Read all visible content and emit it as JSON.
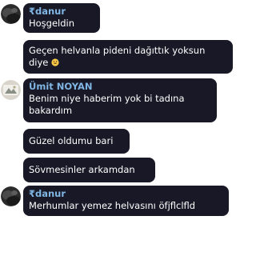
{
  "messages": [
    {
      "sender": "₹danur",
      "lines": [
        "Hoşgeldin"
      ]
    },
    {
      "sender": "",
      "lines": [
        "Geçen helvanla pideni dağıttık yoksun",
        "diye"
      ],
      "emoji": "grinning-sweat-emoji"
    },
    {
      "sender": "Ümit NOYAN",
      "lines": [
        "Benim niye haberim yok bi tadına",
        "bakardım"
      ]
    },
    {
      "sender": "",
      "lines": [
        "Güzel oldumu bari"
      ]
    },
    {
      "sender": "",
      "lines": [
        "Sövmesinler arkamdan"
      ]
    },
    {
      "sender": "₹danur",
      "lines": [
        "Merhumlar yemez helvasını öfjflclfld"
      ]
    }
  ],
  "avatars": [
    {
      "user": "₹danur",
      "icon": "dark-avatar-icon"
    },
    {
      "user": "Ümit NOYAN",
      "icon": "photo-avatar-icon"
    },
    {
      "user": "₹danur",
      "icon": "dark-avatar-icon"
    }
  ],
  "colors": {
    "bubble_bg": "#191826",
    "sender_name": "#7fb6e4",
    "text": "#ffffff",
    "page_bg": "#ffffff"
  }
}
